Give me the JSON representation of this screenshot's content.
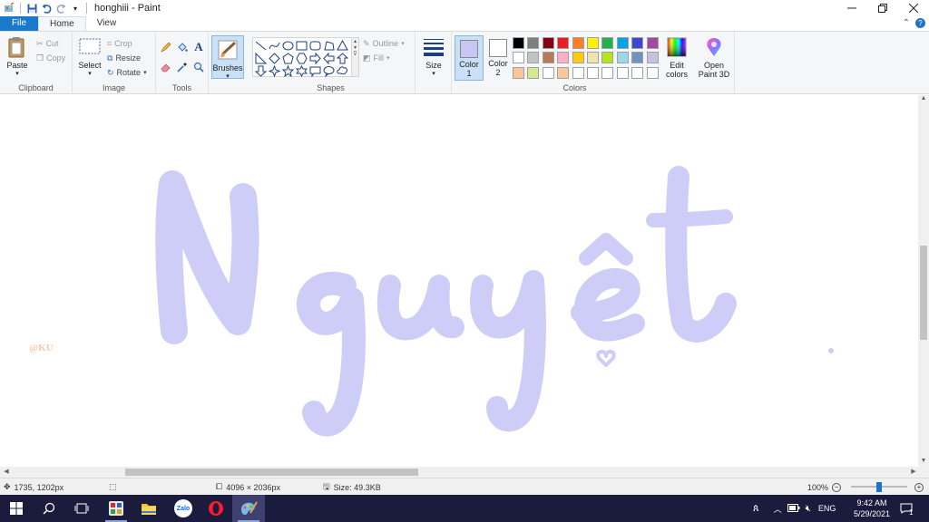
{
  "titlebar": {
    "document_title": "honghiii - Paint"
  },
  "tabs": [
    {
      "label": "File"
    },
    {
      "label": "Home"
    },
    {
      "label": "View"
    }
  ],
  "ribbon": {
    "clipboard": {
      "label": "Clipboard",
      "paste": "Paste",
      "cut": "Cut",
      "copy": "Copy"
    },
    "image": {
      "label": "Image",
      "select": "Select",
      "crop": "Crop",
      "resize": "Resize",
      "rotate": "Rotate"
    },
    "tools": {
      "label": "Tools"
    },
    "brushes": {
      "label": "Brushes"
    },
    "shapes": {
      "label": "Shapes",
      "outline": "Outline",
      "fill": "Fill"
    },
    "size": {
      "label": "Size"
    },
    "colors": {
      "label": "Colors",
      "color1_label": "Color\n1",
      "color1_top": "Color",
      "color1_num": "1",
      "color2_top": "Color",
      "color2_num": "2",
      "color1_value": "#c8c6f2",
      "color2_value": "#ffffff",
      "edit_top": "Edit",
      "edit_bottom": "colors",
      "paint3d_top": "Open",
      "paint3d_bottom": "Paint 3D",
      "palette": [
        "#000000",
        "#7f7f7f",
        "#880015",
        "#ed1c24",
        "#ff7f27",
        "#fff200",
        "#22b14c",
        "#00a2e8",
        "#3f48cc",
        "#a349a4",
        "#ffffff",
        "#c3c3c3",
        "#b97a57",
        "#ffaec9",
        "#ffc90e",
        "#efe4b0",
        "#b5e61d",
        "#99d9ea",
        "#7092be",
        "#c8bfe7",
        "#f9c59a",
        "#d7e88a",
        "#ffffff",
        "#fbc89e",
        "#ffffff",
        "#ffffff",
        "#ffffff",
        "#ffffff",
        "#ffffff",
        "#ffffff"
      ]
    }
  },
  "canvas": {
    "artwork_text": "Nguyệt",
    "watermark": "@KU",
    "top_color": "#fde0cc",
    "bottom_color": "#cdcdf7"
  },
  "status": {
    "cursor_pos": "1735, 1202px",
    "image_size": "4096 × 2036px",
    "file_size": "Size: 49.3KB",
    "zoom": "100%"
  },
  "taskbar": {
    "language": "ENG",
    "time": "9:42 AM",
    "date": "5/29/2021",
    "notification_count": "1"
  }
}
